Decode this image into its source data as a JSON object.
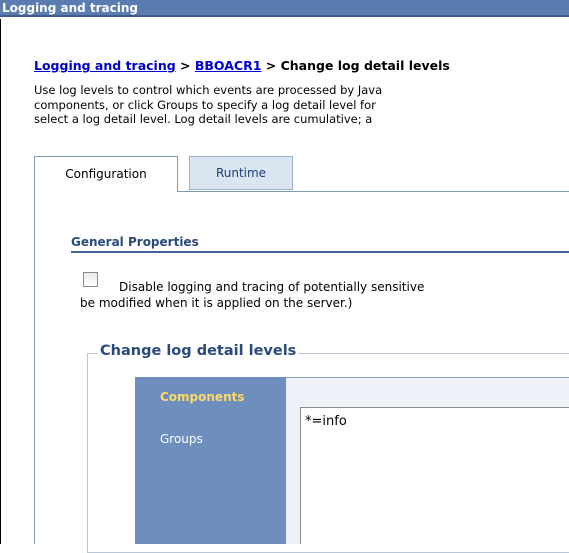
{
  "window": {
    "title": "Logging and tracing"
  },
  "breadcrumb": {
    "link1": "Logging and tracing",
    "sep1": " > ",
    "link2": "BBOACR1",
    "sep2": " > ",
    "current": "Change log detail levels"
  },
  "description": {
    "line1": "Use log levels to control which events are processed by Java",
    "line2": "components, or click Groups to specify a log detail level for",
    "line3": "select a log detail level. Log detail levels are cumulative; a"
  },
  "tabs": [
    {
      "label": "Configuration",
      "selected": true
    },
    {
      "label": "Runtime",
      "selected": false
    }
  ],
  "general_properties": {
    "title": "General Properties",
    "checkbox": {
      "checked": false,
      "label_line1": "Disable logging and tracing of potentially sensitive",
      "label_line2": "be modified when it is applied on the server.)"
    }
  },
  "log_levels": {
    "legend": "Change log detail levels",
    "components_label": "Components",
    "groups_label": "Groups",
    "spec_value": "*=info"
  },
  "colors": {
    "titlebar": "#5a7cb0",
    "sidebar": "#6e8ebe",
    "active_sidebar_text": "#ffd966",
    "link": "#0000cc",
    "section_title": "#2a4a7c"
  }
}
